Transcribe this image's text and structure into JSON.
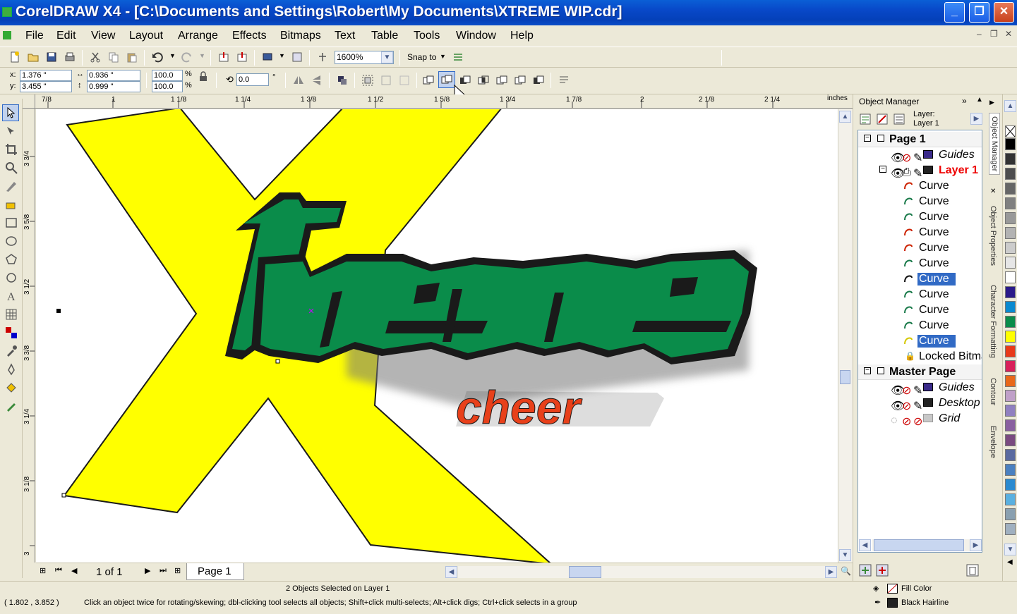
{
  "window": {
    "title": "CorelDRAW X4 - [C:\\Documents and Settings\\Robert\\My Documents\\XTREME WIP.cdr]",
    "minimize": "_",
    "restore": "❐",
    "close": "✕"
  },
  "menu": {
    "items": [
      "File",
      "Edit",
      "View",
      "Layout",
      "Arrange",
      "Effects",
      "Bitmaps",
      "Text",
      "Table",
      "Tools",
      "Window",
      "Help"
    ]
  },
  "toolbar": {
    "zoom": "1600%",
    "snap_to": "Snap to"
  },
  "property_bar": {
    "x_label": "x:",
    "x_value": "1.376 \"",
    "y_label": "y:",
    "y_value": "3.455 \"",
    "width_value": "0.936 \"",
    "height_value": "0.999 \"",
    "scale_x": "100.0",
    "scale_y": "100.0",
    "percent": "%",
    "rotation": "0.0",
    "degree": "°"
  },
  "rulers": {
    "units": "inches",
    "h_labels": [
      "7/8",
      "1",
      "1 1/8",
      "1 1/4",
      "1 3/8",
      "1 1/2",
      "1 5/8",
      "1 3/4",
      "1 7/8",
      "2",
      "2 1/8",
      "2 1/4"
    ],
    "v_labels": [
      "3 3/4",
      "3 5/8",
      "3 1/2",
      "3 3/8",
      "3 1/4",
      "3 1/8",
      "3"
    ]
  },
  "artwork": {
    "main_word": "treme",
    "sub_word": "cheer",
    "colors": {
      "x_yellow": "#ffff00",
      "text_green": "#0a8c4a",
      "outline": "#1a1a1a",
      "cheer_red": "#e8401a"
    }
  },
  "page_nav": {
    "counter": "1 of 1",
    "tab": "Page 1"
  },
  "object_manager": {
    "title": "Object Manager",
    "layer_label": "Layer:",
    "layer_name": "Layer 1",
    "tree": [
      {
        "label": "Page 1",
        "kind": "page"
      },
      {
        "label": "Guides",
        "kind": "layer",
        "color": "#3a2a8a"
      },
      {
        "label": "Layer 1",
        "kind": "active-layer",
        "color": "#222222"
      },
      {
        "label": "Curve",
        "icon_color": "#cc2200",
        "selected": false
      },
      {
        "label": "Curve",
        "icon_color": "#1a7a4a",
        "selected": false
      },
      {
        "label": "Curve",
        "icon_color": "#1a7a4a",
        "selected": false
      },
      {
        "label": "Curve",
        "icon_color": "#cc2200",
        "selected": false
      },
      {
        "label": "Curve",
        "icon_color": "#cc2200",
        "selected": false
      },
      {
        "label": "Curve",
        "icon_color": "#1a7a4a",
        "selected": false
      },
      {
        "label": "Curve",
        "icon_color": "#111111",
        "selected": true
      },
      {
        "label": "Curve",
        "icon_color": "#1a7a4a",
        "selected": false
      },
      {
        "label": "Curve",
        "icon_color": "#1a7a4a",
        "selected": false
      },
      {
        "label": "Curve",
        "icon_color": "#1a7a4a",
        "selected": false
      },
      {
        "label": "Curve",
        "icon_color": "#d4c800",
        "selected": true
      },
      {
        "label": "Locked Bitma",
        "kind": "locked"
      },
      {
        "label": "Master Page",
        "kind": "page"
      },
      {
        "label": "Guides",
        "kind": "layer",
        "color": "#3a2a8a"
      },
      {
        "label": "Desktop",
        "kind": "layer",
        "color": "#222222"
      },
      {
        "label": "Grid",
        "kind": "layer",
        "color": "#c8c8c8"
      }
    ]
  },
  "side_tabs": [
    "Object Manager",
    "Object Properties",
    "Character Formatting",
    "Contour",
    "Envelope"
  ],
  "palette": [
    "#000000",
    "#333333",
    "#4d4d4d",
    "#666666",
    "#808080",
    "#999999",
    "#b3b3b3",
    "#cccccc",
    "#e6e6e6",
    "#ffffff",
    "#2a1a8a",
    "#0a8ad0",
    "#0a8c4a",
    "#ffff00",
    "#e83a1a",
    "#d8205a",
    "#e8681a",
    "#c0a0c8",
    "#9080c0",
    "#8a60a0",
    "#7a4a80",
    "#5a6aa0",
    "#4a80c0",
    "#2a8ad0",
    "#5ab0e0",
    "#8aa0b0",
    "#a0b0c0"
  ],
  "status": {
    "selection": "2 Objects Selected on Layer 1",
    "coords": "( 1.802 , 3.852 )",
    "hint": "Click an object twice for rotating/skewing; dbl-clicking tool selects all objects; Shift+click multi-selects; Alt+click digs; Ctrl+click selects in a group",
    "fill_label": "Fill Color",
    "outline_label": "Black  Hairline"
  }
}
